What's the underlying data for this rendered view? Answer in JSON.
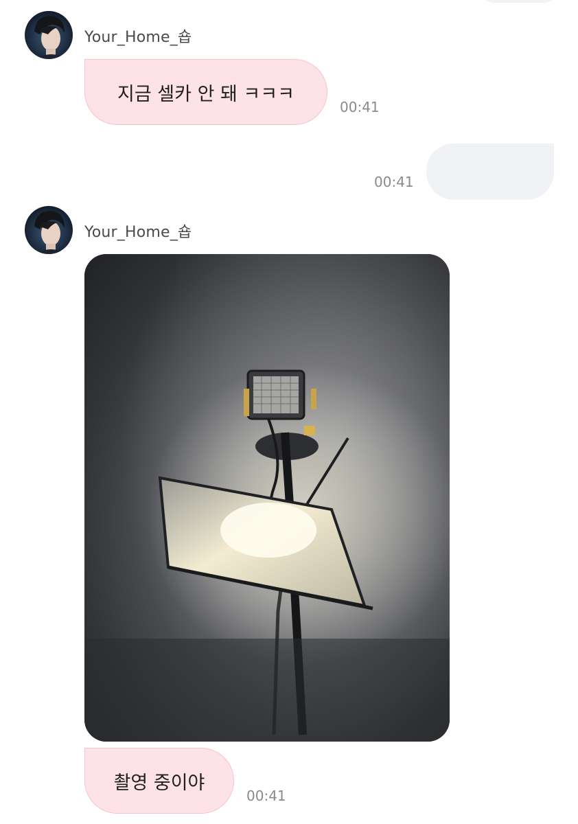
{
  "messages": [
    {
      "sender": "Your_Home_숍",
      "avatar_icon": "profile-avatar",
      "text": "지금 셀카 안 돼 ㅋㅋㅋ",
      "time": "00:41",
      "direction": "incoming"
    },
    {
      "text": "",
      "time": "00:41",
      "direction": "outgoing"
    },
    {
      "sender": "Your_Home_숍",
      "avatar_icon": "profile-avatar",
      "photo": "film-set-light-photo",
      "direction": "incoming"
    },
    {
      "text": "촬영 중이야",
      "time": "00:41",
      "direction": "incoming"
    }
  ],
  "colors": {
    "incoming_bubble": "#fde3e7",
    "incoming_border": "#f6c3cc",
    "outgoing_bubble": "#f1f2f5",
    "timestamp": "#8a8a8a",
    "sender_name": "#4a4a4a"
  }
}
